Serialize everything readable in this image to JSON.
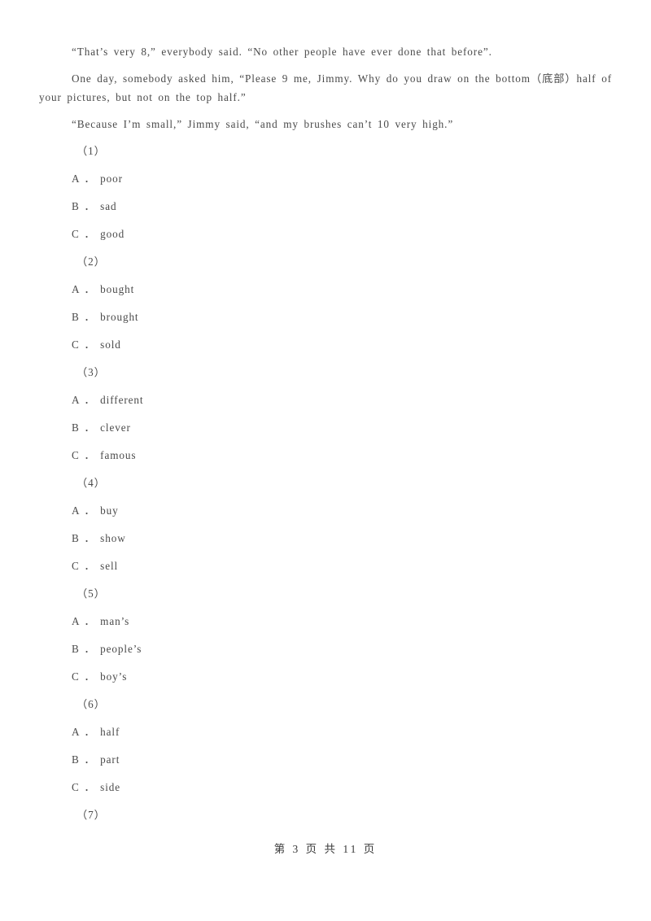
{
  "document": {
    "paragraphs": [
      "“That’s very 8,”  everybody said.  “No other people have ever done that before”.",
      "One day, somebody asked him, “Please 9 me, Jimmy. Why do you draw on the bottom（底部）half of your pictures, but not on the top half.”",
      "“Because I’m small,” Jimmy said, “and my brushes can’t 10 very high.”"
    ],
    "questions": [
      {
        "number": "（1）",
        "options": [
          "A ． poor",
          "B ． sad",
          "C ． good"
        ]
      },
      {
        "number": "（2）",
        "options": [
          "A ． bought",
          "B ． brought",
          "C ． sold"
        ]
      },
      {
        "number": "（3）",
        "options": [
          "A ． different",
          "B ． clever",
          "C ． famous"
        ]
      },
      {
        "number": "（4）",
        "options": [
          "A ． buy",
          "B ． show",
          "C ． sell"
        ]
      },
      {
        "number": "（5）",
        "options": [
          "A ． man’s",
          "B ． people’s",
          "C ． boy’s"
        ]
      },
      {
        "number": "（6）",
        "options": [
          "A ． half",
          "B ． part",
          "C ． side"
        ]
      },
      {
        "number": "（7）",
        "options": []
      }
    ],
    "footer": {
      "text": "第 3 页 共 11 页",
      "current_page": "3",
      "total_pages": "11"
    }
  }
}
